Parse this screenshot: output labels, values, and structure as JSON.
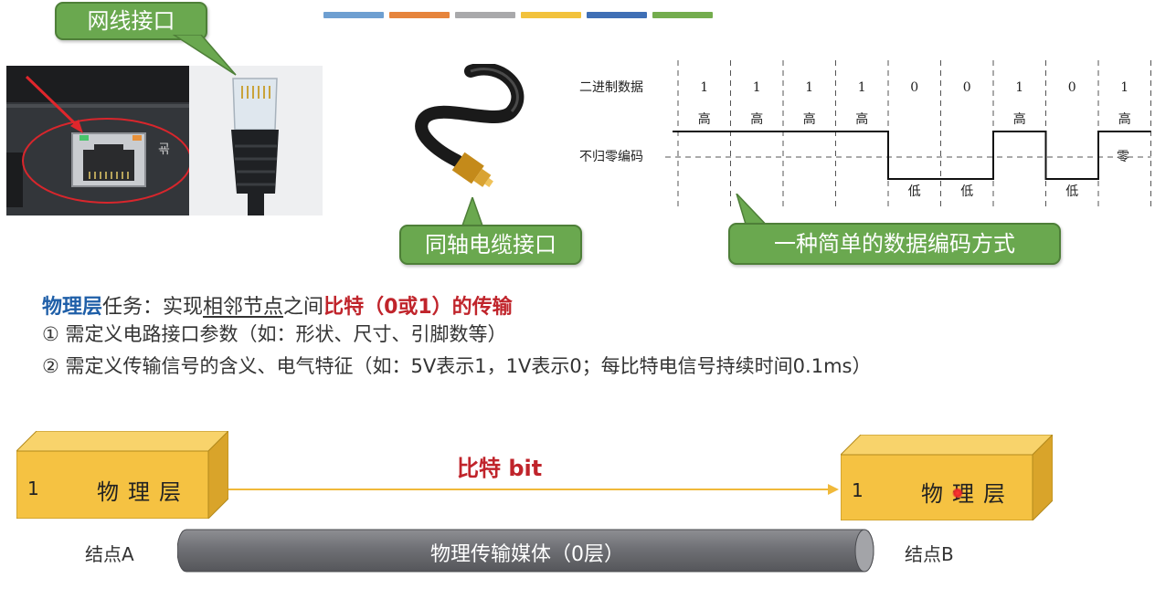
{
  "colors": {
    "strip": [
      "#6e9fd1",
      "#e6843c",
      "#a9a9ab",
      "#f2c23c",
      "#3f6fb5",
      "#74ad4e"
    ],
    "callout_green": "#6aa84f",
    "box_yellow": "#f5c242",
    "title_blue": "#1f5fa8",
    "highlight_red": "#c0242b"
  },
  "callouts": {
    "ethernet": "网线接口",
    "coax": "同轴电缆接口",
    "encoding": "一种简单的数据编码方式"
  },
  "encoding_diagram": {
    "row_binary_label": "二进制数据",
    "row_nrz_label": "不归零编码",
    "bits": [
      "1",
      "1",
      "1",
      "1",
      "0",
      "0",
      "1",
      "0",
      "1"
    ],
    "levels": [
      "高",
      "高",
      "高",
      "高",
      "低",
      "低",
      "高",
      "低",
      "高"
    ],
    "zero_label": "零"
  },
  "text": {
    "line1_title": "物理层",
    "line1_a": "任务：实现",
    "line1_underlined": "相邻节点",
    "line1_b": "之间",
    "line1_red": "比特（0或1）的传输",
    "item1": "①  需定义电路接口参数（如：形状、尺寸、引脚数等）",
    "item2": "②  需定义传输信号的含义、电气特征（如：5V表示1，1V表示0；每比特电信号持续时间0.1ms）"
  },
  "transfer": {
    "bit_label": "比特 bit",
    "left_box": {
      "num": "1",
      "label": "物理层"
    },
    "right_box": {
      "num": "1",
      "label": "物理层"
    },
    "node_a": "结点A",
    "node_b": "结点B",
    "medium": "物理传输媒体（0层）"
  }
}
